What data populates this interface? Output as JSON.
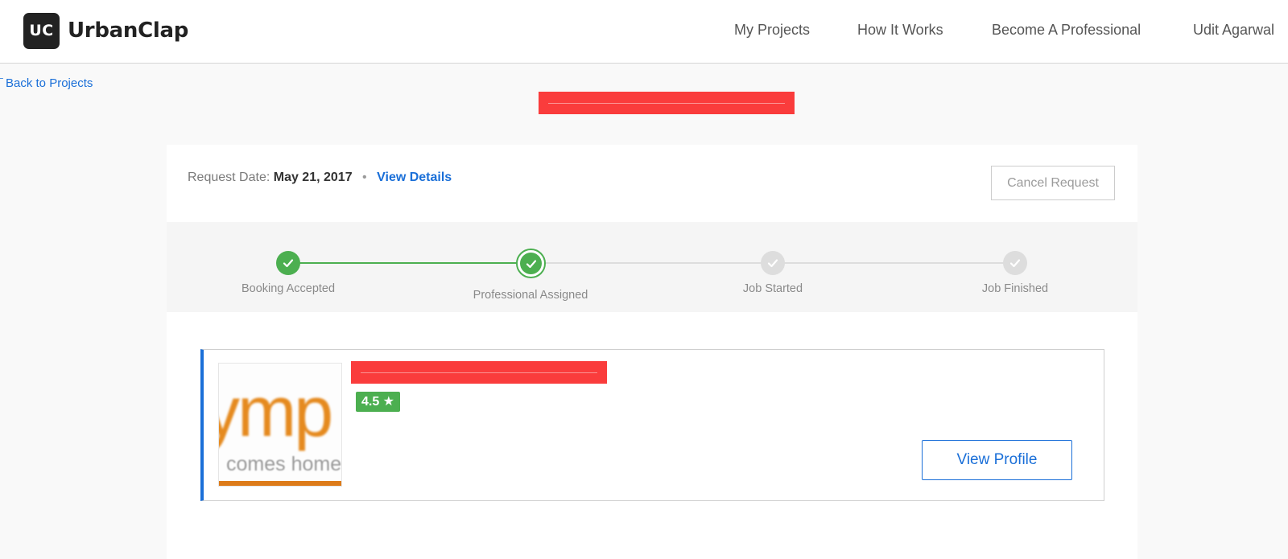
{
  "header": {
    "logo_badge": "UC",
    "logo_text": "UrbanClap",
    "nav": [
      {
        "label": "My Projects"
      },
      {
        "label": "How It Works"
      },
      {
        "label": "Become A Professional"
      },
      {
        "label": "Udit Agarwal"
      }
    ]
  },
  "back_link": {
    "arrow": "←",
    "label": "Back to Projects"
  },
  "request": {
    "date_label": "Request Date:",
    "date_value": "May 21, 2017",
    "separator": "•",
    "view_details": "View Details",
    "cancel_label": "Cancel Request"
  },
  "progress": {
    "steps": [
      {
        "label": "Booking Accepted",
        "status": "done"
      },
      {
        "label": "Professional Assigned",
        "status": "current"
      },
      {
        "label": "Job Started",
        "status": "pending"
      },
      {
        "label": "Job Finished",
        "status": "pending"
      }
    ],
    "check_icon": "check-icon"
  },
  "professional": {
    "photo_main": "ymp",
    "photo_sub": "comes home",
    "rating": "4.5",
    "rating_star": "★",
    "view_profile": "View Profile"
  },
  "colors": {
    "brand_dark": "#222222",
    "link_blue": "#1a6fd8",
    "success_green": "#4caf50",
    "pending_gray": "#dddddd",
    "redaction_red": "#fa3c3c",
    "accent_orange": "#e58a1f"
  }
}
